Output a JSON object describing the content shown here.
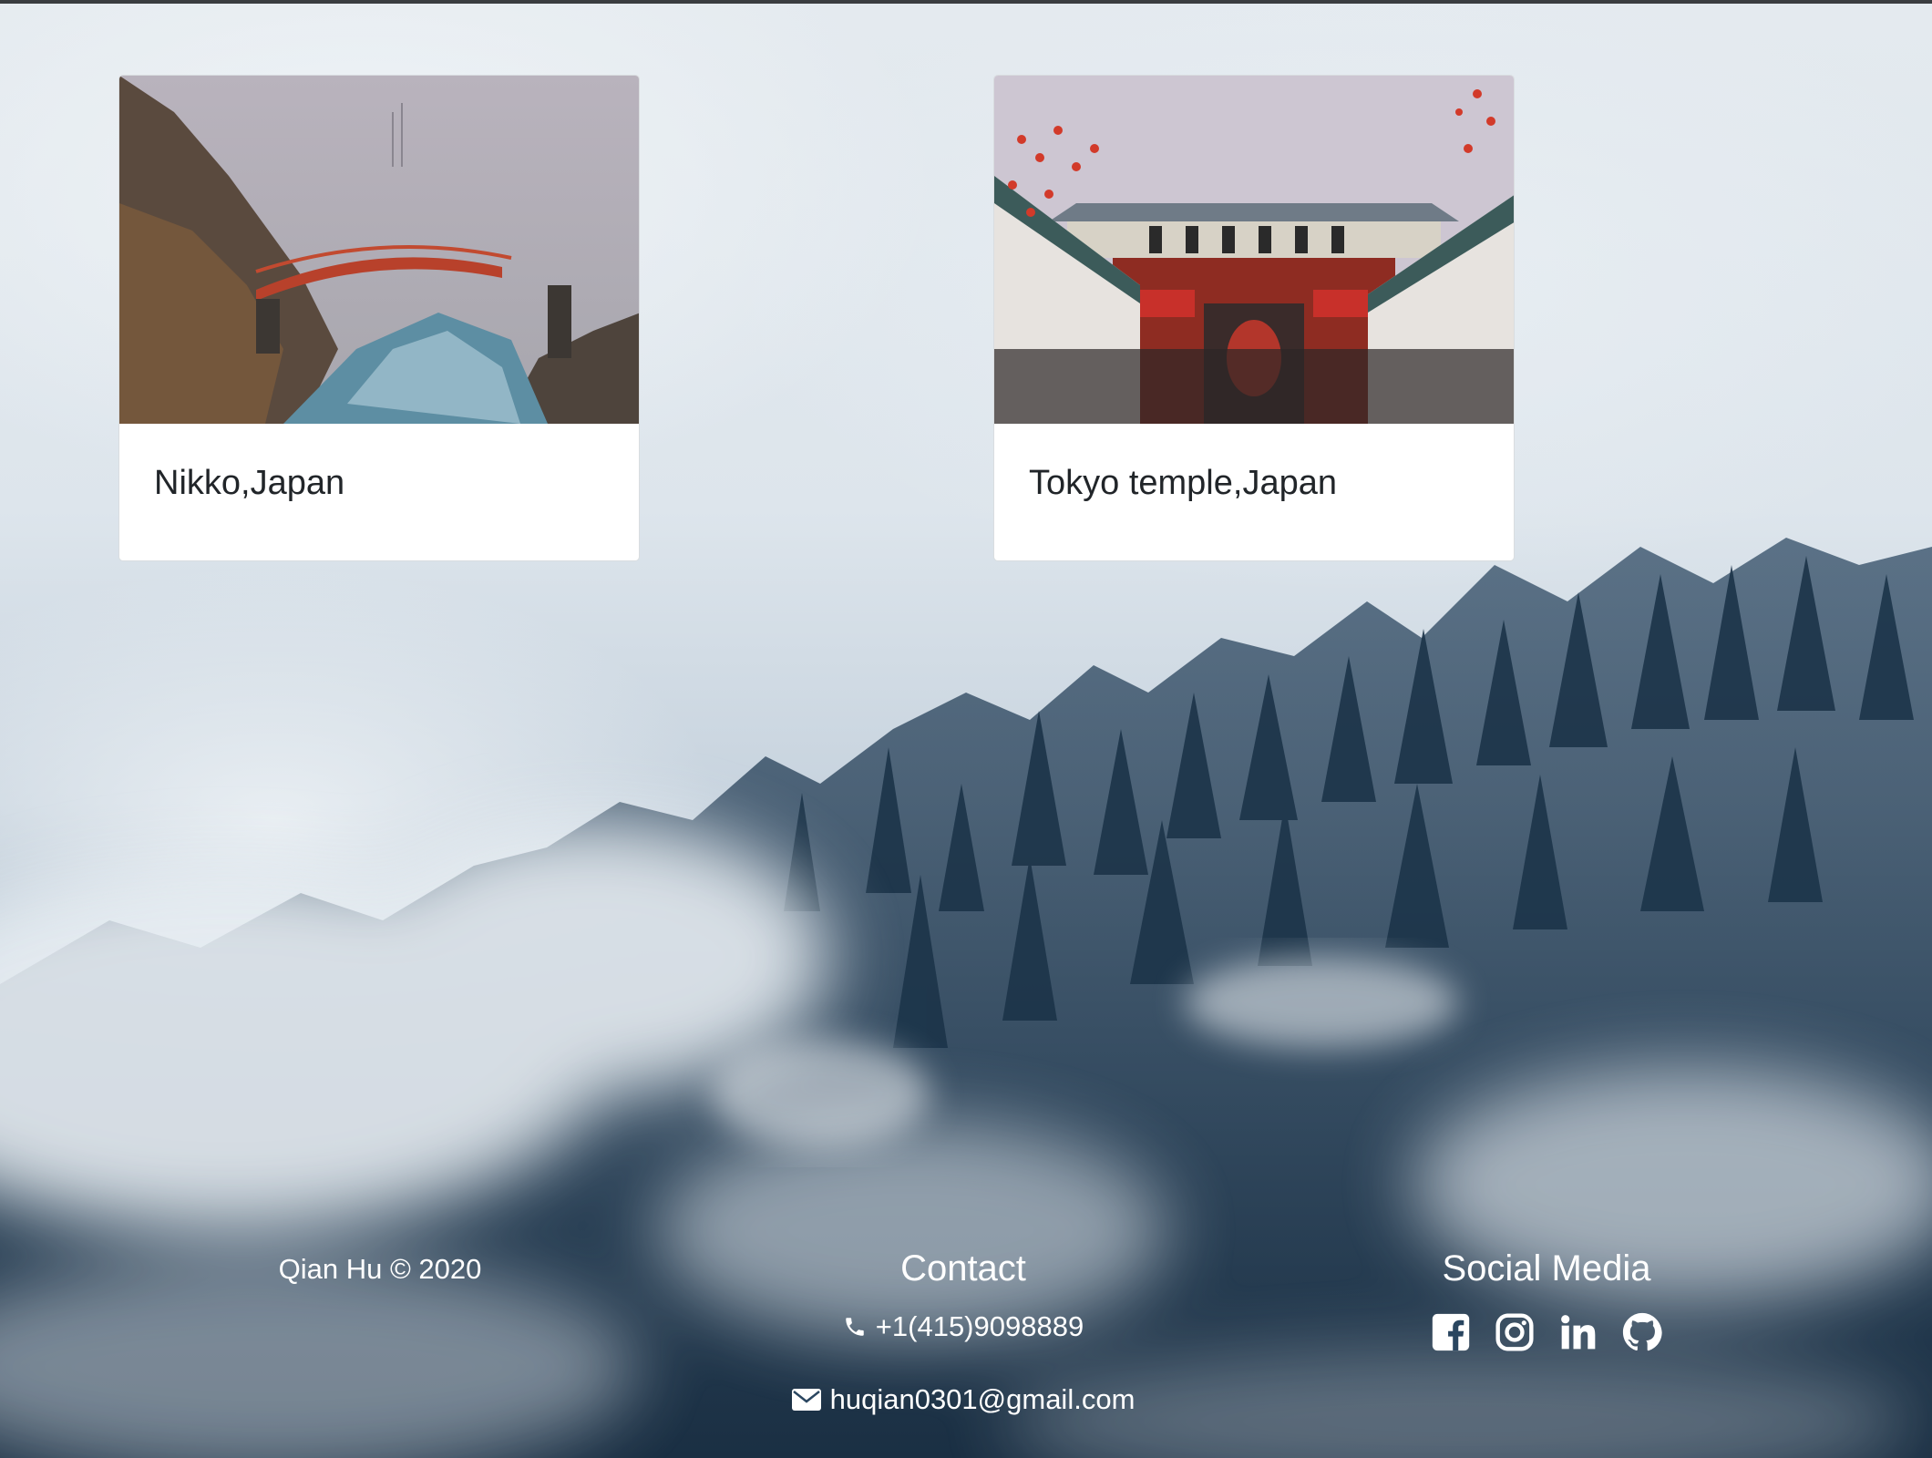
{
  "cards": [
    {
      "title": "Nikko,Japan",
      "image": "nikko-bridge-photo"
    },
    {
      "title": "Tokyo temple,Japan",
      "image": "tokyo-temple-photo"
    }
  ],
  "footer": {
    "copyright": "Qian Hu © 2020",
    "contact": {
      "heading": "Contact",
      "phone": "+1(415)9098889",
      "email": "huqian0301@gmail.com"
    },
    "social": {
      "heading": "Social Media",
      "icons": [
        "facebook-icon",
        "instagram-icon",
        "linkedin-icon",
        "github-icon"
      ]
    }
  },
  "colors": {
    "card_bg": "#ffffff",
    "title_text": "#212529",
    "footer_text": "#ffffff",
    "forest_dark": "#1f3a52"
  }
}
